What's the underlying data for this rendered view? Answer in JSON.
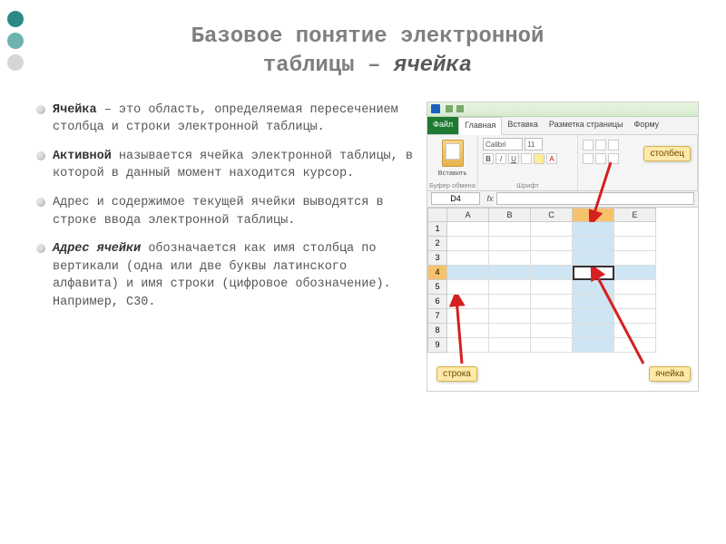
{
  "title": {
    "line1": "Базовое понятие электронной",
    "line2_prefix": "таблицы – ",
    "line2_em": "ячейка"
  },
  "dots_colors": [
    "#2b8a86",
    "#6fb3af",
    "#d6d6d6"
  ],
  "bullets": [
    {
      "bold": "Ячейка",
      "rest": " – это область, определяемая пересечением столбца и строки электронной таблицы."
    },
    {
      "bold": "Активной",
      "rest": " называется ячейка электронной таблицы, в которой в данный момент находится курсор."
    },
    {
      "bold": "",
      "rest": "Адрес и содержимое текущей ячейки выводятся в строке ввода электронной таблицы."
    },
    {
      "bold_italic": "Адрес ячейки",
      "rest": " обозначается как имя столбца по вертикали (одна или две буквы латинского алфавита) и имя строки (цифровое обозначение). Например, С30."
    }
  ],
  "excel": {
    "tabs": {
      "file": "Файл",
      "home": "Главная",
      "insert": "Вставка",
      "layout": "Разметка страницы",
      "formulas": "Форму"
    },
    "ribbon": {
      "paste": "Вставить",
      "clipboard_label": "Буфер обмена",
      "font_name": "Calibri",
      "font_size": "11",
      "font_label": "Шрифт"
    },
    "namebox": "D4",
    "fx": "fx",
    "columns": [
      "A",
      "B",
      "C",
      "D",
      "E"
    ],
    "rows": [
      "1",
      "2",
      "3",
      "4",
      "5",
      "6",
      "7",
      "8",
      "9"
    ],
    "highlight_col": "D",
    "highlight_row": "4"
  },
  "callouts": {
    "column": "столбец",
    "row": "строка",
    "cell": "ячейка"
  }
}
